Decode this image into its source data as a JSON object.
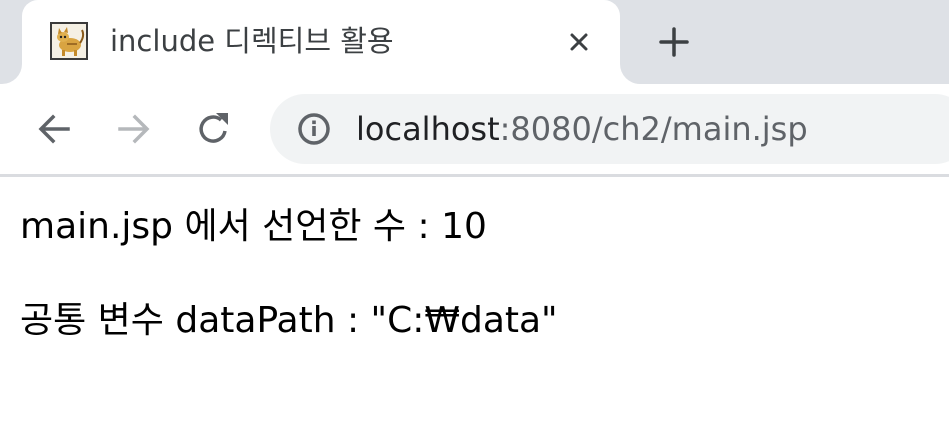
{
  "tab": {
    "title": "include 디렉티브 활용",
    "favicon": "tomcat-icon"
  },
  "toolbar": {
    "back": "back-arrow-icon",
    "forward": "forward-arrow-icon",
    "reload": "reload-icon",
    "new_tab": "plus-icon",
    "close_tab": "close-icon"
  },
  "address_bar": {
    "host": "localhost",
    "rest": ":8080/ch2/main.jsp",
    "site_info": "info-icon"
  },
  "page": {
    "line1": "main.jsp 에서 선언한 수 : 10",
    "line2": "공통 변수 dataPath : \"C:₩data\""
  },
  "colors": {
    "tabstrip_bg": "#dee1e6",
    "omnibox_bg": "#f1f3f4",
    "icon_active": "#5f6368",
    "icon_disabled": "#b5b8bb",
    "text": "#000000"
  }
}
